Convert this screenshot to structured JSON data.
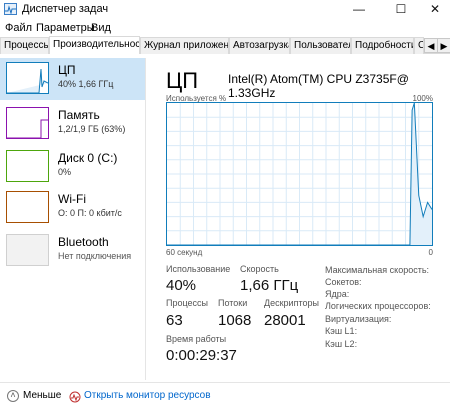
{
  "window": {
    "title": "Диспетчер задач",
    "min": "—",
    "max": "☐",
    "close": "✕"
  },
  "menu": [
    "Файл",
    "Параметры",
    "Вид"
  ],
  "tabs": [
    "Процессы",
    "Производительность",
    "Журнал приложений",
    "Автозагрузка",
    "Пользователи",
    "Подробности",
    "С"
  ],
  "tab_scroll": {
    "left": "◀",
    "right": "▶"
  },
  "sidebar": [
    {
      "title": "ЦП",
      "sub": "40% 1,66 ГГц",
      "color": "#117dbb"
    },
    {
      "title": "Память",
      "sub": "1,2/1,9 ГБ (63%)",
      "color": "#8b12ae"
    },
    {
      "title": "Диск 0 (C:)",
      "sub": "0%",
      "color": "#4da60c"
    },
    {
      "title": "Wi-Fi",
      "sub": "О: 0 П: 0 кбит/с",
      "color": "#a74f01"
    },
    {
      "title": "Bluetooth",
      "sub": "Нет подключения",
      "color": "#999999"
    }
  ],
  "main": {
    "title": "ЦП",
    "model": "Intel(R) Atom(TM) CPU Z3735F@ 1.33GHz",
    "axis_top_left": "Используется %",
    "axis_top_right": "100%",
    "axis_bottom_left": "60 секунд",
    "axis_bottom_right": "0",
    "stats": {
      "usage_label": "Использование",
      "usage": "40%",
      "speed_label": "Скорость",
      "speed": "1,66 ГГц",
      "processes_label": "Процессы",
      "processes": "63",
      "threads_label": "Потоки",
      "threads": "1068",
      "handles_label": "Дескрипторы",
      "handles": "28001",
      "uptime_label": "Время работы",
      "uptime": "0:00:29:37"
    },
    "side_labels": [
      "Максимальная скорость:",
      "Сокетов:",
      "Ядра:",
      "Логических процессоров:",
      "Виртуализация:",
      "Кэш L1:",
      "Кэш L2:"
    ]
  },
  "footer": {
    "less": "Меньше",
    "monitor": "Открыть монитор ресурсов"
  },
  "chart_data": {
    "type": "area",
    "x": [
      60,
      50,
      40,
      30,
      20,
      10,
      6,
      5,
      4.5,
      4,
      3,
      2,
      1,
      0
    ],
    "values": [
      0,
      0,
      0,
      0,
      0,
      0,
      0,
      0,
      95,
      100,
      35,
      20,
      30,
      25
    ],
    "ylim": [
      0,
      100
    ],
    "grid": true
  }
}
